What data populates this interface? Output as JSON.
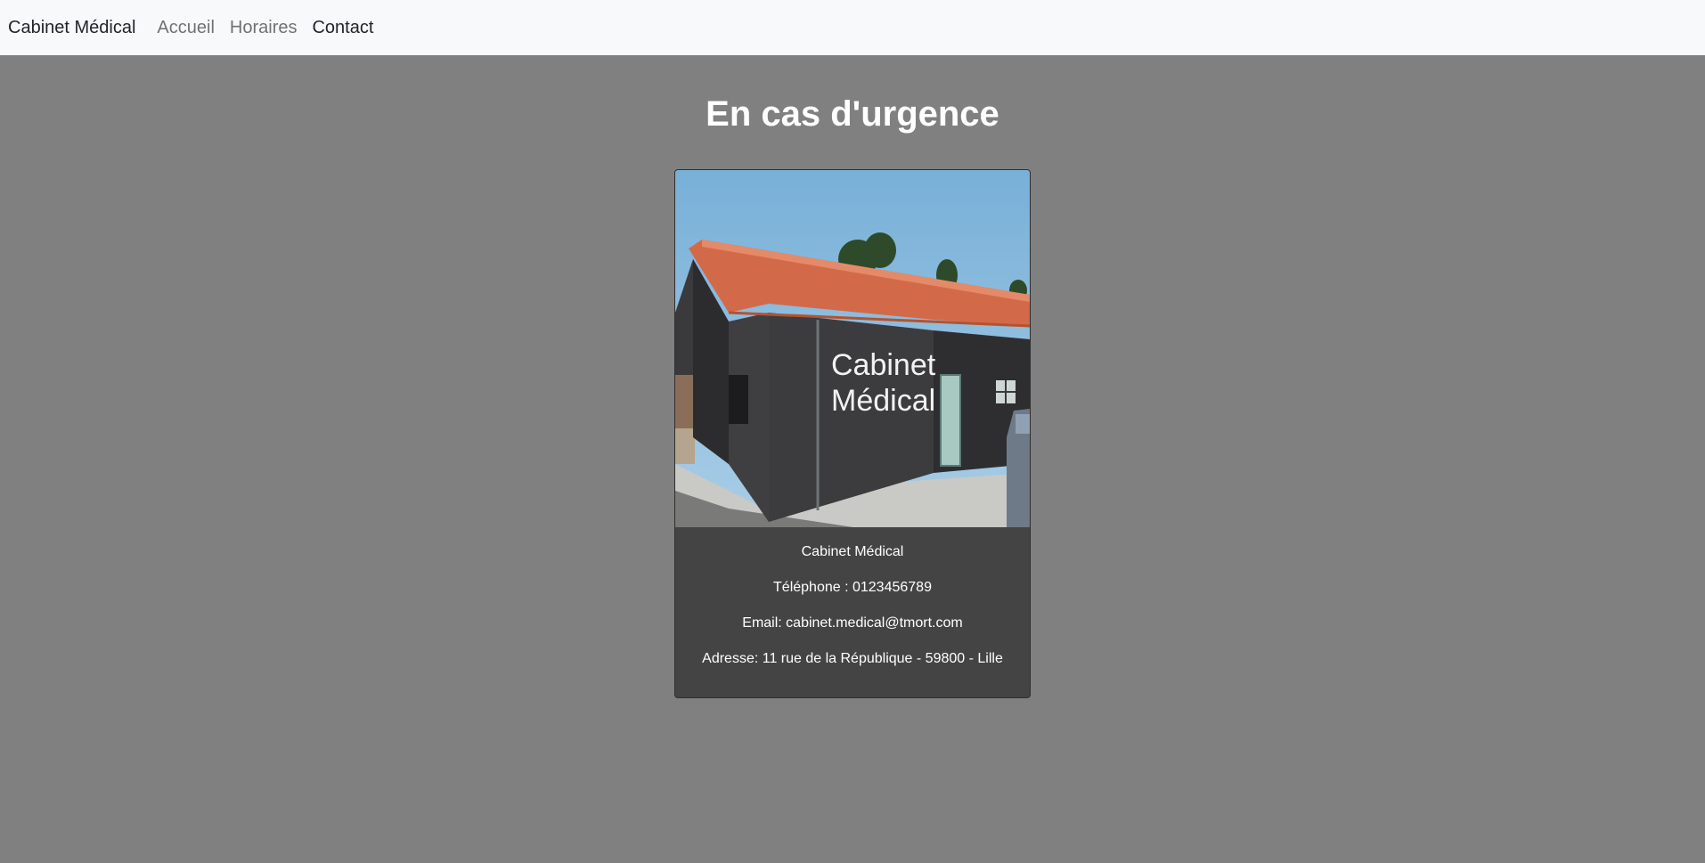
{
  "navbar": {
    "brand": "Cabinet Médical",
    "links": [
      {
        "label": "Accueil"
      },
      {
        "label": "Horaires"
      },
      {
        "label": "Contact"
      }
    ]
  },
  "page": {
    "title": "En cas d'urgence"
  },
  "card": {
    "photo_sign": {
      "line1": "Cabinet",
      "line2": "Médical"
    },
    "name": "Cabinet Médical",
    "phone": "Téléphone : 0123456789",
    "email": "Email: cabinet.medical@tmort.com",
    "address": "Adresse: 11 rue de la République - 59800 - Lille"
  }
}
